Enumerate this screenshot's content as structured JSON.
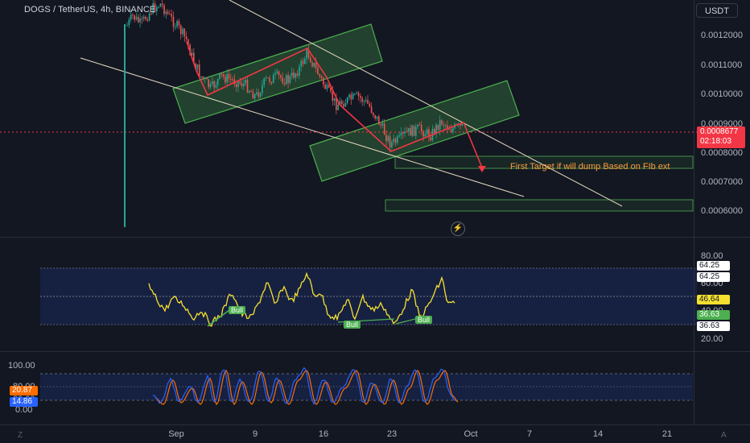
{
  "header": {
    "title": "DOGS / TetherUS, 4h, BINANCE",
    "currency": "USDT"
  },
  "price_axis": [
    "0.0012000",
    "0.0011000",
    "0.0010000",
    "0.0009000",
    "0.0008000",
    "0.0007000",
    "0.0006000"
  ],
  "price_tag": {
    "price": "0.0008677",
    "countdown": "02:18:03"
  },
  "annotation": "First Target if will dump Based on FIb ext",
  "rsi_axis": [
    "80.00",
    "60.00",
    "40.00",
    "20.00"
  ],
  "rsi_tags": {
    "upper1": "64.25",
    "upper2": "64.25",
    "value": "46.64",
    "lower1": "36.63",
    "lower2": "36.63"
  },
  "bull_labels": [
    "Bull",
    "Bull",
    "Bull"
  ],
  "stoch_axis": [
    "100.00",
    "80.00",
    "20.00",
    "0.00"
  ],
  "stoch_tags": {
    "k": "20.87",
    "d": "14.86"
  },
  "time_axis": [
    "Sep",
    "9",
    "16",
    "23",
    "Oct",
    "7",
    "14",
    "21"
  ],
  "corners": {
    "left": "Z",
    "right": "A"
  },
  "colors": {
    "bg": "#131722",
    "bull_candle": "#26a69a",
    "bear_candle": "#ef5350",
    "channel": "#4caf50",
    "rsi": "#f5e030",
    "stoch_k": "#2962ff",
    "stoch_d": "#ff6d00",
    "price_line": "#f23645",
    "annotation": "#ff9a3c"
  }
}
